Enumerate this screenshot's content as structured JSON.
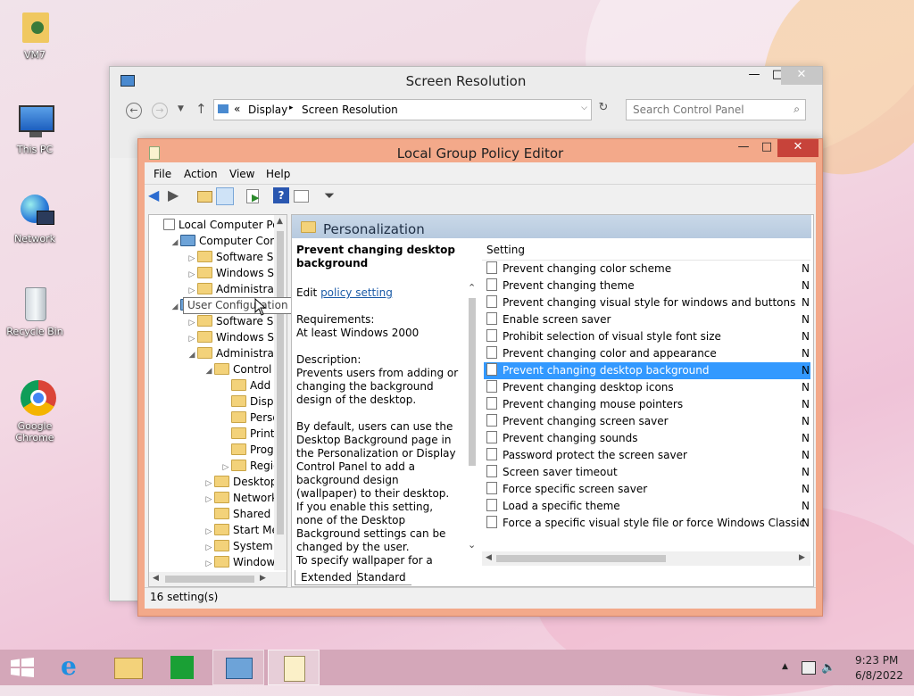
{
  "desktop": {
    "icons": [
      {
        "label": "VM7"
      },
      {
        "label": "This PC"
      },
      {
        "label": "Network"
      },
      {
        "label": "Recycle Bin"
      },
      {
        "label": "Google Chrome"
      }
    ]
  },
  "screen_resolution": {
    "title": "Screen Resolution",
    "breadcrumb": [
      "Display",
      "Screen Resolution"
    ],
    "breadcrumb_prefix": "«",
    "search_placeholder": "Search Control Panel"
  },
  "gpe": {
    "title": "Local Group Policy Editor",
    "menu": [
      "File",
      "Action",
      "View",
      "Help"
    ],
    "tree": [
      {
        "label": "Local Computer Polic",
        "indent": 0,
        "arrow": ""
      },
      {
        "label": "Computer Config",
        "indent": 1,
        "arrow": "◢"
      },
      {
        "label": "Software Setti",
        "indent": 2,
        "arrow": "▷"
      },
      {
        "label": "Windows Sett",
        "indent": 2,
        "arrow": "▷"
      },
      {
        "label": "Administrative",
        "indent": 2,
        "arrow": "▷"
      },
      {
        "label": "User Configuration",
        "indent": 1,
        "arrow": "◢"
      },
      {
        "label": "Software Setti",
        "indent": 2,
        "arrow": "▷"
      },
      {
        "label": "Windows Sett",
        "indent": 2,
        "arrow": "▷"
      },
      {
        "label": "Administrative",
        "indent": 2,
        "arrow": "◢"
      },
      {
        "label": "Control Pa",
        "indent": 3,
        "arrow": "◢"
      },
      {
        "label": "Add or",
        "indent": 4,
        "arrow": ""
      },
      {
        "label": "Display",
        "indent": 4,
        "arrow": ""
      },
      {
        "label": "Person",
        "indent": 4,
        "arrow": ""
      },
      {
        "label": "Printer",
        "indent": 4,
        "arrow": ""
      },
      {
        "label": "Progra",
        "indent": 4,
        "arrow": ""
      },
      {
        "label": "Region",
        "indent": 4,
        "arrow": "▷"
      },
      {
        "label": "Desktop",
        "indent": 3,
        "arrow": "▷"
      },
      {
        "label": "Network",
        "indent": 3,
        "arrow": "▷"
      },
      {
        "label": "Shared Fol",
        "indent": 3,
        "arrow": ""
      },
      {
        "label": "Start Menu",
        "indent": 3,
        "arrow": "▷"
      },
      {
        "label": "System",
        "indent": 3,
        "arrow": "▷"
      },
      {
        "label": "Windows C",
        "indent": 3,
        "arrow": "▷"
      }
    ],
    "tooltip": "User Configuration",
    "section_title": "Personalization",
    "desc": {
      "heading": "Prevent changing desktop background",
      "edit_prefix": "Edit ",
      "edit_link": "policy setting",
      "req_label": "Requirements:",
      "req_value": "At least Windows 2000",
      "desc_label": "Description:",
      "p1": "Prevents users from adding or changing the background design of the desktop.",
      "p2": "By default, users can use the Desktop Background page in the Personalization or Display Control Panel to add a background design (wallpaper) to their desktop.",
      "p3": "If you enable this setting, none of the Desktop Background settings can be changed by the user.",
      "p4": "To specify wallpaper for a group,"
    },
    "settings_header": "Setting",
    "settings": [
      {
        "name": "Prevent changing color scheme",
        "state": "N"
      },
      {
        "name": "Prevent changing theme",
        "state": "N"
      },
      {
        "name": "Prevent changing visual style for windows and buttons",
        "state": "N"
      },
      {
        "name": "Enable screen saver",
        "state": "N"
      },
      {
        "name": "Prohibit selection of visual style font size",
        "state": "N"
      },
      {
        "name": "Prevent changing color and appearance",
        "state": "N"
      },
      {
        "name": "Prevent changing desktop background",
        "state": "N"
      },
      {
        "name": "Prevent changing desktop icons",
        "state": "N"
      },
      {
        "name": "Prevent changing mouse pointers",
        "state": "N"
      },
      {
        "name": "Prevent changing screen saver",
        "state": "N"
      },
      {
        "name": "Prevent changing sounds",
        "state": "N"
      },
      {
        "name": "Password protect the screen saver",
        "state": "N"
      },
      {
        "name": "Screen saver timeout",
        "state": "N"
      },
      {
        "name": "Force specific screen saver",
        "state": "N"
      },
      {
        "name": "Load a specific theme",
        "state": "N"
      },
      {
        "name": "Force a specific visual style file or force Windows Classic",
        "state": "N"
      }
    ],
    "selected_index": 6,
    "tabs": [
      "Extended",
      "Standard"
    ],
    "status": "16 setting(s)"
  },
  "taskbar": {
    "time": "9:23 PM",
    "date": "6/8/2022"
  },
  "colors": {
    "accent_titlebar": "#f3a98a",
    "selection": "#3399ff",
    "taskbar": "#d4a7b9"
  }
}
